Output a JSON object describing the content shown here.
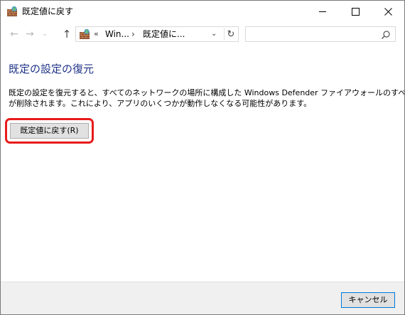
{
  "window": {
    "title": "既定値に戻す",
    "controls": {
      "minimize": "—",
      "maximize": "☐",
      "close": "✕"
    }
  },
  "navigation": {
    "back_icon": "←",
    "forward_icon": "→",
    "recent_icon": "⌄",
    "up_icon": "↑",
    "address": {
      "overflow": "«",
      "segment1": "Win...",
      "separator": "›",
      "segment2": "既定値に...",
      "dropdown": "⌄",
      "refresh": "↻"
    },
    "search": {
      "placeholder": ""
    }
  },
  "content": {
    "heading": "既定の設定の復元",
    "description_line1": "既定の設定を復元すると、すべてのネットワークの場所に構成した Windows Defender ファイアウォールのすべての設定",
    "description_line2": "が削除されます。これにより、アプリのいくつかが動作しなくなる可能性があります。",
    "restore_button": "既定値に戻す(R)"
  },
  "footer": {
    "cancel_button": "キャンセル"
  },
  "colors": {
    "heading": "#1e3287",
    "highlight": "#e81b1b",
    "footer_bg": "#f0f0f0",
    "focus_border": "#0078d7"
  }
}
